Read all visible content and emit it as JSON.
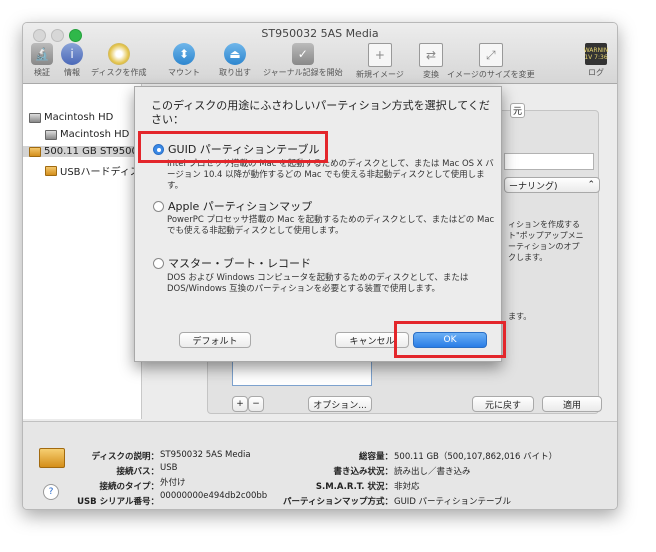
{
  "window": {
    "title": "ST950032 5AS Media"
  },
  "toolbar": {
    "items": [
      {
        "label": "検証",
        "icon": "microscope-icon"
      },
      {
        "label": "情報",
        "icon": "info-icon"
      },
      {
        "label": "ディスクを作成",
        "icon": "burn-icon"
      },
      {
        "label": "マウント",
        "icon": "mount-icon"
      },
      {
        "label": "取り出す",
        "icon": "eject-icon"
      },
      {
        "label": "ジャーナル記録を開始",
        "icon": "journal-icon"
      },
      {
        "label": "新規イメージ",
        "icon": "new-image-icon"
      },
      {
        "label": "変換",
        "icon": "convert-icon"
      },
      {
        "label": "イメージのサイズを変更",
        "icon": "resize-image-icon"
      },
      {
        "label": "ログ",
        "icon": "log-icon",
        "log_text": "WARNIN\n1V 7:36"
      }
    ]
  },
  "sidebar": {
    "items": [
      {
        "label": "Macintosh HD"
      },
      {
        "label": "Macintosh HD"
      },
      {
        "label": "500.11 GB ST9500"
      },
      {
        "label": "USBハードディス"
      }
    ]
  },
  "background_panel": {
    "tab_fragment": "元",
    "popup_fragment": "ーナリング)",
    "side_text": [
      "ィションを作成する",
      "ト\"ポップアップメニ",
      "ーティションのオプ",
      "クします。"
    ],
    "side_text2": "ます。",
    "add_symbol": "+",
    "remove_symbol": "−",
    "options_button": "オプション...",
    "revert_button": "元に戻す",
    "apply_button": "適用"
  },
  "sheet": {
    "title": "このディスクの用途にふさわしいパーティション方式を選択してください：",
    "options": [
      {
        "label": "GUID パーティションテーブル",
        "selected": true,
        "description": "Intel プロセッサ搭載の Mac を起動するためのディスクとして、または Mac OS X バージョン 10.4 以降が動作するどの Mac でも使える非起動ディスクとして使用します。"
      },
      {
        "label": "Apple パーティションマップ",
        "selected": false,
        "description": "PowerPC プロセッサ搭載の Mac を起動するためのディスクとして、またはどの Mac でも使える非起動ディスクとして使用します。"
      },
      {
        "label": "マスター・ブート・レコード",
        "selected": false,
        "description": "DOS および Windows コンピュータを起動するためのディスクとして、または DOS/Windows 互換のパーティションを必要とする装置で使用します。"
      }
    ],
    "default_button": "デフォルト",
    "cancel_button": "キャンセル",
    "ok_button": "OK"
  },
  "info": {
    "left": [
      {
        "key": "ディスクの説明：",
        "value": "ST950032 5AS Media"
      },
      {
        "key": "接続バス：",
        "value": "USB"
      },
      {
        "key": "接続のタイプ：",
        "value": "外付け"
      },
      {
        "key": "USB シリアル番号：",
        "value": "00000000e494db2c00bb"
      }
    ],
    "right": [
      {
        "key": "総容量：",
        "value": "500.11 GB（500,107,862,016 バイト）"
      },
      {
        "key": "書き込み状況：",
        "value": "読み出し／書き込み"
      },
      {
        "key": "S.M.A.R.T. 状況：",
        "value": "非対応"
      },
      {
        "key": "パーティションマップ方式：",
        "value": "GUID パーティションテーブル"
      }
    ],
    "help": "?"
  },
  "colors": {
    "accent": "#3a89e6",
    "highlight_box": "#e3262b"
  }
}
